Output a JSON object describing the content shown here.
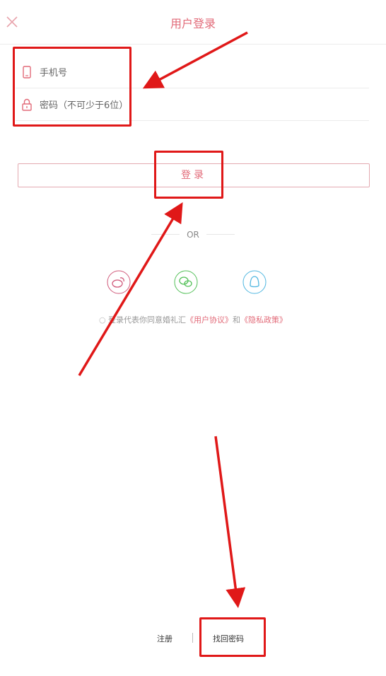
{
  "header": {
    "title": "用户登录",
    "close_icon": "close-icon"
  },
  "form": {
    "phone_placeholder": "手机号",
    "password_placeholder": "密码（不可少于6位）",
    "login_label": "登录"
  },
  "divider": {
    "text": "OR"
  },
  "social": [
    {
      "name": "weibo-icon",
      "color": "#d0597a"
    },
    {
      "name": "wechat-icon",
      "color": "#53c058"
    },
    {
      "name": "qq-icon",
      "color": "#4fb6e0"
    }
  ],
  "agreement": {
    "prefix": "登录代表你同意婚礼汇",
    "user_agreement": "《用户协议》",
    "and": "和",
    "privacy_policy": "《隐私政策》"
  },
  "footer": {
    "register_label": "注册",
    "recover_label": "找回密码"
  },
  "colors": {
    "accent": "#e26a78",
    "annotation": "#e01818"
  }
}
